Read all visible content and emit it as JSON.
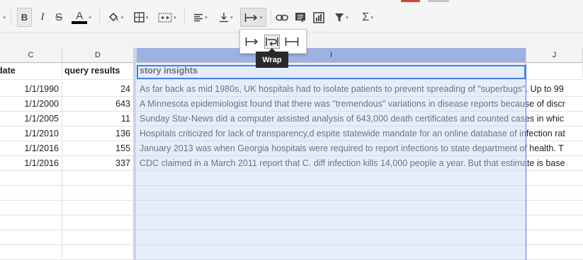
{
  "toolbar": {
    "buttons": [
      {
        "name": "bold-button",
        "label": "B"
      },
      {
        "name": "italic-button",
        "label": "I"
      },
      {
        "name": "strikethrough-button",
        "label": "S"
      },
      {
        "name": "text-color-button",
        "label": "A"
      },
      {
        "name": "fill-color-button",
        "icon": "paint-bucket-icon"
      },
      {
        "name": "borders-button",
        "icon": "borders-icon"
      },
      {
        "name": "merge-cells-button",
        "icon": "merge-icon"
      },
      {
        "name": "horizontal-align-button",
        "icon": "align-left-icon"
      },
      {
        "name": "vertical-align-button",
        "icon": "align-bottom-icon"
      },
      {
        "name": "text-wrapping-button",
        "icon": "overflow-icon"
      },
      {
        "name": "insert-link-button",
        "icon": "link-icon"
      },
      {
        "name": "insert-comment-button",
        "icon": "comment-icon"
      },
      {
        "name": "insert-chart-button",
        "icon": "chart-icon"
      },
      {
        "name": "filter-button",
        "icon": "filter-icon"
      },
      {
        "name": "functions-button",
        "label": "Σ"
      }
    ],
    "text_color": "#000000"
  },
  "wrap_menu": {
    "options": [
      {
        "name": "overflow-option",
        "icon": "overflow-icon",
        "selected": false
      },
      {
        "name": "wrap-option",
        "icon": "wrap-icon",
        "selected": true
      },
      {
        "name": "clip-option",
        "icon": "clip-icon",
        "selected": false
      }
    ],
    "tooltip": "Wrap"
  },
  "grid": {
    "columns": [
      "C",
      "D",
      "I",
      "J"
    ],
    "selected_column": "I",
    "header_row": {
      "c": "date",
      "d": "query results",
      "i": "story insights"
    },
    "rows": [
      {
        "c": "1/1/1990",
        "d": "24",
        "i": "As far back as mid 1980s, UK hospitals had to isolate patients to prevent spreading of \"superbugs\". Up to 99"
      },
      {
        "c": "1/1/2000",
        "d": "643",
        "i": "A Minnesota epidemiologist found that there was \"tremendous\" variations in disease reports because of discr"
      },
      {
        "c": "1/1/2005",
        "d": "11",
        "i": "Sunday Star-News did a computer assisted analysis of 643,000 death certificates and counted cases in whic"
      },
      {
        "c": "1/1/2010",
        "d": "136",
        "i": "Hospitals criticized for lack of transparency,d espite statewide mandate for an online database of infection rat"
      },
      {
        "c": "1/1/2016",
        "d": "155",
        "i": "January 2013 was when Georgia hospitals were required to report infections to state department of health. T"
      },
      {
        "c": "1/1/2016",
        "d": "337",
        "i": "CDC claimed in a March 2011 report that C. diff infection kills 14,000 people a year. But that estimate is base"
      }
    ],
    "empty_rows": 6,
    "selection_color": "#4a7fe0"
  }
}
